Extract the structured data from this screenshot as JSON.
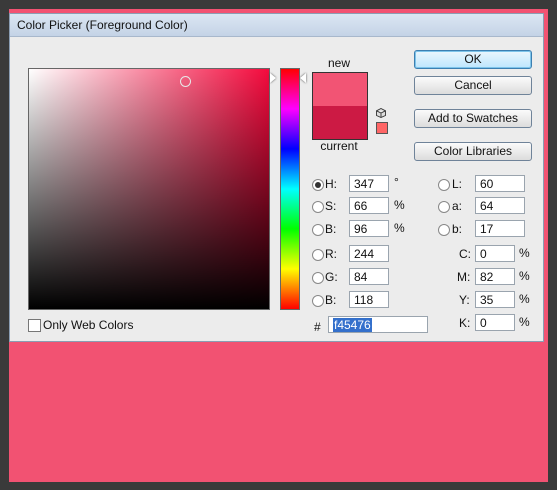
{
  "window": {
    "title": "Color Picker (Foreground Color)"
  },
  "colors": {
    "new": "#f25474",
    "current": "#cc1a44",
    "websafe": "#ff6666",
    "canvas": "#f25272",
    "field_hue": "#f40a3d"
  },
  "preview": {
    "new_label": "new",
    "current_label": "current",
    "cube_icon": "cube-icon"
  },
  "buttons": {
    "ok": "OK",
    "cancel": "Cancel",
    "add_to_swatches": "Add to Swatches",
    "color_libraries": "Color Libraries"
  },
  "fields": {
    "H": {
      "label": "H:",
      "value": "347",
      "unit": "°"
    },
    "S": {
      "label": "S:",
      "value": "66",
      "unit": "%"
    },
    "Bv": {
      "label": "B:",
      "value": "96",
      "unit": "%"
    },
    "R": {
      "label": "R:",
      "value": "244"
    },
    "G": {
      "label": "G:",
      "value": "84"
    },
    "Bc": {
      "label": "B:",
      "value": "118"
    },
    "L": {
      "label": "L:",
      "value": "60"
    },
    "a": {
      "label": "a:",
      "value": "64"
    },
    "b": {
      "label": "b:",
      "value": "17"
    },
    "C": {
      "label": "C:",
      "value": "0",
      "unit": "%"
    },
    "M": {
      "label": "M:",
      "value": "82",
      "unit": "%"
    },
    "Y": {
      "label": "Y:",
      "value": "35",
      "unit": "%"
    },
    "K": {
      "label": "K:",
      "value": "0",
      "unit": "%"
    }
  },
  "hex": {
    "prefix": "#",
    "value": "f45476"
  },
  "web_colors": {
    "label": "Only Web Colors",
    "checked": false
  }
}
